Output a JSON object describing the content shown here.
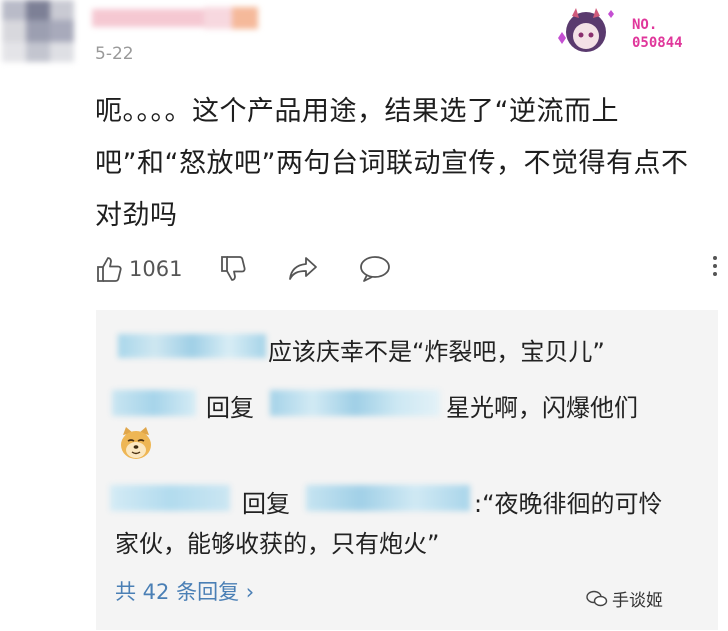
{
  "comment": {
    "date": "5-22",
    "text": "呃。。。。这个产品用途，结果选了“逆流而上吧”和“怒放吧”两句台词联动宣传，不觉得有点不对劲吗",
    "like_count": "1061"
  },
  "badge": {
    "line1": "NO.",
    "line2": "050844"
  },
  "icons": {
    "like": "thumbs-up-icon",
    "dislike": "thumbs-down-icon",
    "share": "share-icon",
    "reply": "comment-bubble-icon",
    "more": "more-vertical-icon",
    "emoji": "doge-emoji-icon"
  },
  "replies": [
    {
      "text": "应该庆幸不是“炸裂吧，宝贝儿”"
    },
    {
      "reply_word": "回复",
      "text": "星光啊，闪爆他们"
    },
    {
      "reply_word": "回复",
      "text_line1": ":“夜晚徘徊的可怜",
      "text_line2": "家伙，能够收获的，只有炮火”"
    }
  ],
  "more_replies": "共 42 条回复 ›",
  "watermark": "手谈姬",
  "colors": {
    "link": "#4a7fb5",
    "badge": "#e0379b",
    "reply_bg": "#f4f4f4"
  }
}
